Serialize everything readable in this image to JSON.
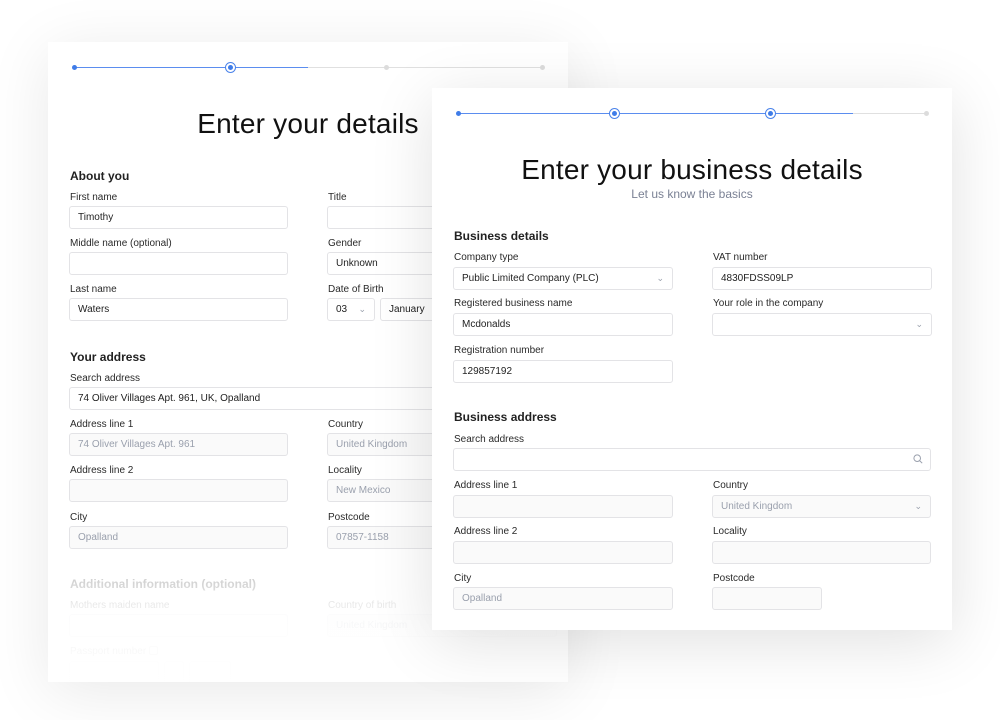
{
  "back_card": {
    "stepper": {
      "total_steps": 4,
      "completed_step": 1,
      "current_step": 2,
      "progress_fraction": 0.5
    },
    "title": "Enter your details",
    "about_section": {
      "heading": "About you",
      "first_name": {
        "label": "First name",
        "value": "Timothy"
      },
      "title_field": {
        "label": "Title",
        "value": ""
      },
      "middle_name": {
        "label": "Middle name (optional)",
        "value": ""
      },
      "gender": {
        "label": "Gender",
        "value": "Unknown"
      },
      "last_name": {
        "label": "Last name",
        "value": "Waters"
      },
      "dob": {
        "label": "Date of Birth",
        "day": "03",
        "month": "January"
      }
    },
    "address_section": {
      "heading": "Your address",
      "search": {
        "label": "Search address",
        "value": "74 Oliver Villages Apt. 961, UK, Opalland"
      },
      "line1": {
        "label": "Address line 1",
        "value": "74 Oliver Villages Apt. 961"
      },
      "country": {
        "label": "Country",
        "value": "United Kingdom"
      },
      "line2": {
        "label": "Address line 2",
        "value": ""
      },
      "locality": {
        "label": "Locality",
        "value": "New Mexico"
      },
      "city": {
        "label": "City",
        "value": "Opalland"
      },
      "postcode": {
        "label": "Postcode",
        "value": "07857-1158"
      }
    },
    "additional_section": {
      "heading": "Additional information (optional)",
      "maiden_name": {
        "label": "Mothers maiden name",
        "value": ""
      },
      "country_of_birth": {
        "label": "Country of birth",
        "value": "United Kingdom"
      },
      "passport": {
        "label": "Passport number",
        "icon": "info-icon"
      }
    }
  },
  "front_card": {
    "stepper": {
      "total_steps": 4,
      "completed_step": 1,
      "current_steps": [
        2,
        3
      ],
      "progress_fraction": 0.85
    },
    "title": "Enter your business details",
    "subtitle": "Let us know the basics",
    "business_section": {
      "heading": "Business details",
      "company_type": {
        "label": "Company type",
        "value": "Public Limited Company (PLC)"
      },
      "vat": {
        "label": "VAT number",
        "value": "4830FDSS09LP"
      },
      "registered_name": {
        "label": "Registered business name",
        "value": "Mcdonalds"
      },
      "role": {
        "label": "Your role in the company",
        "value": ""
      },
      "reg_number": {
        "label": "Registration number",
        "value": "129857192"
      }
    },
    "address_section": {
      "heading": "Business address",
      "search": {
        "label": "Search address",
        "value": "",
        "icon": "search-icon"
      },
      "line1": {
        "label": "Address line 1",
        "value": ""
      },
      "country": {
        "label": "Country",
        "value": "United Kingdom"
      },
      "line2": {
        "label": "Address line 2",
        "value": ""
      },
      "locality": {
        "label": "Locality",
        "value": ""
      },
      "city": {
        "label": "City",
        "value": "Opalland"
      },
      "postcode": {
        "label": "Postcode",
        "value": ""
      }
    }
  },
  "colors": {
    "accent": "#3f7ce8",
    "track": "#e0e0e0",
    "muted_text": "#9aa0ad"
  },
  "icons": {
    "chevron": "⌄"
  }
}
